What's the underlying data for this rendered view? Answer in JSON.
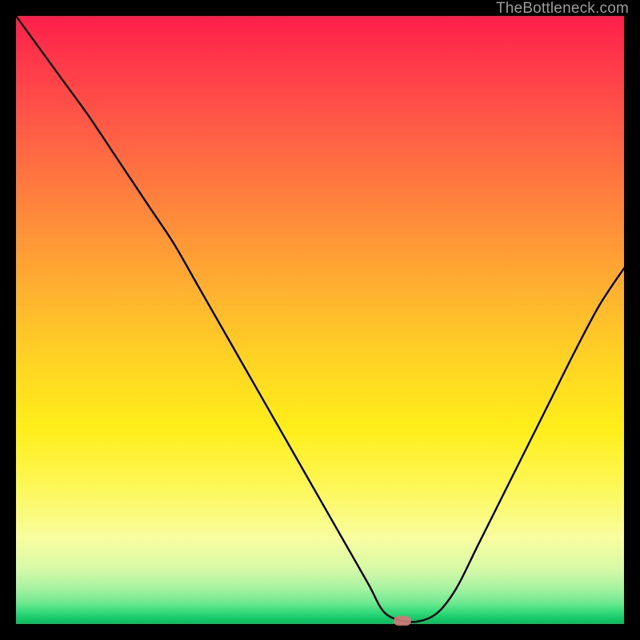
{
  "watermark": "TheBottleneck.com",
  "marker": {
    "x_fraction": 0.635,
    "y_fraction": 0.995
  },
  "chart_data": {
    "type": "line",
    "title": "",
    "xlabel": "",
    "ylabel": "",
    "xlim": [
      0,
      1
    ],
    "ylim": [
      0,
      1
    ],
    "grid": false,
    "legend": false,
    "series": [
      {
        "name": "curve",
        "x": [
          0.0,
          0.04,
          0.08,
          0.12,
          0.16,
          0.2,
          0.22,
          0.26,
          0.3,
          0.34,
          0.38,
          0.42,
          0.46,
          0.5,
          0.54,
          0.58,
          0.605,
          0.635,
          0.665,
          0.695,
          0.725,
          0.76,
          0.8,
          0.84,
          0.88,
          0.92,
          0.96,
          1.0
        ],
        "y": [
          1.0,
          0.945,
          0.89,
          0.835,
          0.775,
          0.715,
          0.685,
          0.625,
          0.555,
          0.485,
          0.415,
          0.345,
          0.275,
          0.205,
          0.135,
          0.065,
          0.02,
          0.005,
          0.005,
          0.02,
          0.06,
          0.13,
          0.21,
          0.29,
          0.37,
          0.45,
          0.525,
          0.585
        ]
      }
    ],
    "annotations": [
      {
        "type": "marker",
        "x": 0.635,
        "y": 0.005,
        "style": "pill",
        "color": "#d07a78"
      }
    ],
    "background": "vertical-gradient red→orange→yellow→green"
  }
}
